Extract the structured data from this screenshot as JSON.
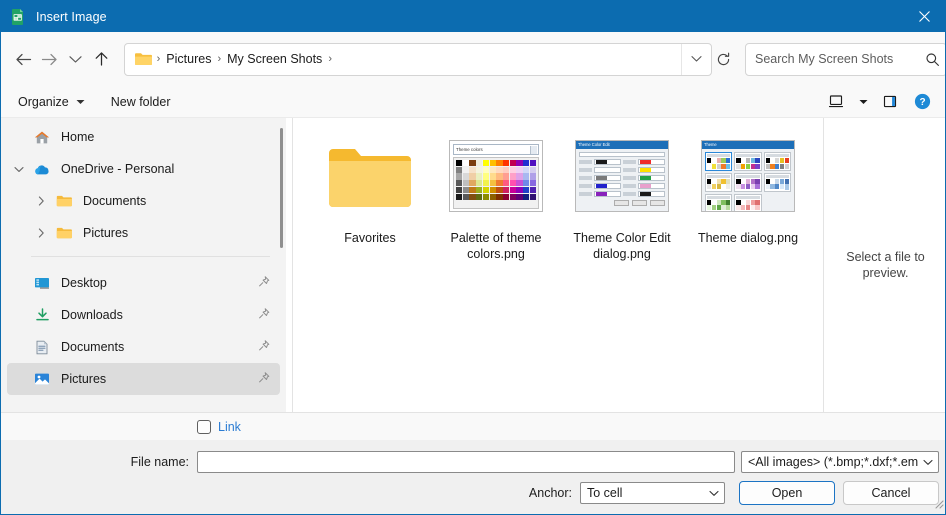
{
  "window": {
    "title": "Insert Image",
    "title_icon": "spreadsheet-image-icon",
    "close_label": "Close",
    "accent_color": "#0c6cb0",
    "link_color": "#2b7cd3"
  },
  "nav": {
    "back": "Back",
    "forward": "Forward",
    "recent": "Recent locations",
    "up": "Up",
    "refresh": "Refresh",
    "address_chevron": "Previous locations",
    "breadcrumbs": [
      "Pictures",
      "My Screen Shots"
    ],
    "separator": "›"
  },
  "search": {
    "placeholder": "Search My Screen Shots",
    "value": "",
    "icon": "search-icon"
  },
  "command_bar": {
    "organize": "Organize",
    "new_folder": "New folder",
    "view_icon": "view-layout-icon",
    "view_caret_icon": "chevron-down-icon",
    "preview_pane_icon": "preview-pane-icon",
    "help_icon": "help-icon"
  },
  "sidebar": {
    "items": [
      {
        "label": "Home",
        "icon": "home-icon",
        "expander": "",
        "indent": 0,
        "pinned": false,
        "selected": false
      },
      {
        "label": "OneDrive - Personal",
        "icon": "onedrive-cloud-icon",
        "expander": "down",
        "indent": 0,
        "pinned": false,
        "selected": false
      },
      {
        "label": "Documents",
        "icon": "folder-icon",
        "expander": "right",
        "indent": 1,
        "pinned": false,
        "selected": false
      },
      {
        "label": "Pictures",
        "icon": "folder-icon",
        "expander": "right",
        "indent": 1,
        "pinned": false,
        "selected": false
      }
    ],
    "items2": [
      {
        "label": "Desktop",
        "icon": "desktop-icon",
        "pinned": true,
        "selected": false
      },
      {
        "label": "Downloads",
        "icon": "downloads-icon",
        "pinned": true,
        "selected": false
      },
      {
        "label": "Documents",
        "icon": "document-icon",
        "pinned": true,
        "selected": false
      },
      {
        "label": "Pictures",
        "icon": "pictures-icon",
        "pinned": true,
        "selected": true
      }
    ]
  },
  "files": [
    {
      "name": "Favorites",
      "type": "folder"
    },
    {
      "name": "Palette of theme colors.png",
      "type": "image",
      "thumb": "color-palette-dropdown",
      "thumb_title": "Theme colors"
    },
    {
      "name": "Theme Color Edit dialog.png",
      "type": "image",
      "thumb": "theme-color-edit-dialog",
      "thumb_title": "Theme Color Edit"
    },
    {
      "name": "Theme dialog.png",
      "type": "image",
      "thumb": "theme-dialog",
      "thumb_title": "Theme"
    }
  ],
  "preview": {
    "message": "Select a file to preview."
  },
  "link_row": {
    "checkbox_label": "Link",
    "checked": false
  },
  "footer": {
    "file_name_label": "File name:",
    "file_name_value": "",
    "filter_value": "<All images> (*.bmp;*.dxf;*.em",
    "anchor_label": "Anchor:",
    "anchor_value": "To cell",
    "open_label": "Open",
    "cancel_label": "Cancel"
  },
  "thumb_palette": {
    "rows": [
      [
        "#000000",
        "#ffffff",
        "#7b3f10",
        "#efeedd",
        "#ffff00",
        "#ffbf00",
        "#ff8000",
        "#ff3300",
        "#c00050",
        "#9000b0",
        "#2030d0",
        "#5010c0"
      ],
      [
        "#808080",
        "#f2f2f2",
        "#f6e2c9",
        "#f4f4e0",
        "#ffffbf",
        "#ffe9bf",
        "#ffd9bf",
        "#ffccbf",
        "#ffd0e2",
        "#efd0f4",
        "#d0d8f8",
        "#d4ccf0"
      ],
      [
        "#a6a6a6",
        "#d9d9d9",
        "#f0cfa6",
        "#eaf0c0",
        "#ffff80",
        "#ffdb8c",
        "#ffbb80",
        "#ff9e90",
        "#ffa0c8",
        "#e0a0e8",
        "#a8b8f0",
        "#b0a0e8"
      ],
      [
        "#595959",
        "#bfbfbf",
        "#e0a860",
        "#dde890",
        "#f2f24d",
        "#f4c040",
        "#f07a30",
        "#ff5a80",
        "#ff4fb0",
        "#c850d8",
        "#7088e8",
        "#8868e0"
      ],
      [
        "#404040",
        "#8c8c8c",
        "#c07a18",
        "#9cb020",
        "#d4d400",
        "#d09000",
        "#c05010",
        "#d02060",
        "#c80098",
        "#9000b8",
        "#2040c8",
        "#5020b0"
      ],
      [
        "#1a1a1a",
        "#595959",
        "#804f10",
        "#5f6c10",
        "#8c8c00",
        "#8c6000",
        "#803000",
        "#8c0030",
        "#800060",
        "#600078",
        "#102080",
        "#301070"
      ]
    ]
  },
  "thumb_edit_dialog": {
    "swatches": [
      "#1a1a1a",
      "#ef2b2b",
      "#ffffff",
      "#ffe000",
      "#7a7a7a",
      "#24a148",
      "#2222cc",
      "#e8a0cc",
      "#8822bb"
    ]
  },
  "thumb_theme_dialog": {
    "cards": [
      {
        "selected": true,
        "colors": [
          "#000000",
          "#ffffff",
          "#e8b0b0",
          "#9ccc5a",
          "#2b6fd4",
          "#ffffff",
          "#f2e03a",
          "#d0d0d0",
          "#ef7a2a",
          "#6ac0e8"
        ]
      },
      {
        "selected": false,
        "colors": [
          "#000000",
          "#ffffff",
          "#b8b8b8",
          "#6fb8e0",
          "#2b46c0",
          "#e0e0e0",
          "#f2a000",
          "#8ad040",
          "#c03090",
          "#7a40c8"
        ]
      },
      {
        "selected": false,
        "colors": [
          "#000000",
          "#ffffff",
          "#d8d8d8",
          "#e8c020",
          "#e84020",
          "#c0c0c0",
          "#f08020",
          "#4080d0",
          "#808080",
          "#d0d0d0"
        ]
      },
      {
        "selected": false,
        "colors": [
          "#000000",
          "#ffffff",
          "#f0e0b0",
          "#f0c030",
          "#e0e0c0",
          "#e8e8e8",
          "#f0d060",
          "#d8b840",
          "#ffffff",
          "#eeeeee"
        ]
      },
      {
        "selected": false,
        "colors": [
          "#000000",
          "#ffffff",
          "#e0b0d8",
          "#b070c8",
          "#7a40b0",
          "#f0e0f0",
          "#c890e0",
          "#9060c8",
          "#e8d0f0",
          "#a870d8"
        ]
      },
      {
        "selected": false,
        "colors": [
          "#000000",
          "#ffffff",
          "#c8d8e8",
          "#7aa8d8",
          "#4070b0",
          "#e8f0f8",
          "#90b8e0",
          "#5088c8",
          "#d8e8f8",
          "#a8c8e8"
        ]
      },
      {
        "selected": false,
        "colors": [
          "#000000",
          "#ffffff",
          "#d0e8c0",
          "#80c060",
          "#408030",
          "#e8f8e0",
          "#a0d080",
          "#60a848",
          "#e0f0d8",
          "#b8dca0"
        ]
      },
      {
        "selected": false,
        "colors": [
          "#000000",
          "#ffffff",
          "#f8d8d8",
          "#f0a0a0",
          "#e07070",
          "#fce8e8",
          "#f4b8b8",
          "#e88888",
          "#fdf0f0",
          "#f8c8c8"
        ]
      }
    ]
  }
}
